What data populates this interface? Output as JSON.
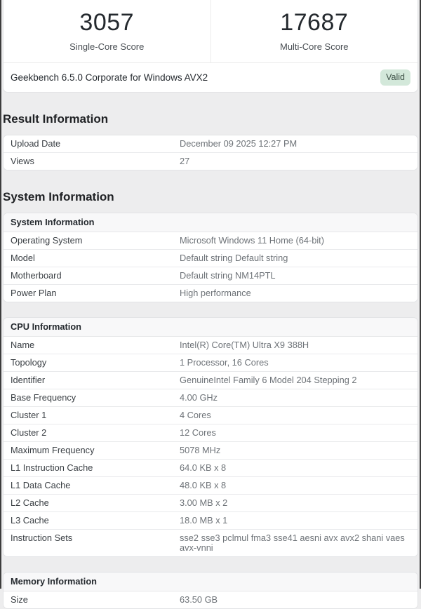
{
  "page": {
    "background": "#ededee",
    "edge_color": "#3d3d3d"
  },
  "scores": {
    "single_core": {
      "value": "3057",
      "label": "Single-Core Score"
    },
    "multi_core": {
      "value": "17687",
      "label": "Multi-Core Score"
    },
    "benchmark_name": "Geekbench 6.5.0 Corporate for Windows AVX2",
    "badge": {
      "label": "Valid",
      "bg": "#d3e8da",
      "color": "#3e5247"
    }
  },
  "result_information": {
    "heading": "Result Information",
    "rows": [
      {
        "label": "Upload Date",
        "value": "December 09 2025 12:27 PM"
      },
      {
        "label": "Views",
        "value": "27"
      }
    ]
  },
  "system_information": {
    "heading": "System Information",
    "system": {
      "title": "System Information",
      "rows": [
        {
          "label": "Operating System",
          "value": "Microsoft Windows 11 Home (64-bit)"
        },
        {
          "label": "Model",
          "value": "Default string Default string"
        },
        {
          "label": "Motherboard",
          "value": "Default string NM14PTL"
        },
        {
          "label": "Power Plan",
          "value": "High performance"
        }
      ]
    },
    "cpu": {
      "title": "CPU Information",
      "rows": [
        {
          "label": "Name",
          "value": "Intel(R) Core(TM) Ultra X9 388H"
        },
        {
          "label": "Topology",
          "value": "1 Processor, 16 Cores"
        },
        {
          "label": "Identifier",
          "value": "GenuineIntel Family 6 Model 204 Stepping 2"
        },
        {
          "label": "Base Frequency",
          "value": "4.00 GHz"
        },
        {
          "label": "Cluster 1",
          "value": "4 Cores"
        },
        {
          "label": "Cluster 2",
          "value": "12 Cores"
        },
        {
          "label": "Maximum Frequency",
          "value": "5078 MHz"
        },
        {
          "label": "L1 Instruction Cache",
          "value": "64.0 KB x 8"
        },
        {
          "label": "L1 Data Cache",
          "value": "48.0 KB x 8"
        },
        {
          "label": "L2 Cache",
          "value": "3.00 MB x 2"
        },
        {
          "label": "L3 Cache",
          "value": "18.0 MB x 1"
        },
        {
          "label": "Instruction Sets",
          "value": "sse2 sse3 pclmul fma3 sse41 aesni avx avx2 shani vaes avx-vnni"
        }
      ]
    },
    "memory": {
      "title": "Memory Information",
      "rows": [
        {
          "label": "Size",
          "value": "63.50 GB"
        }
      ]
    }
  }
}
